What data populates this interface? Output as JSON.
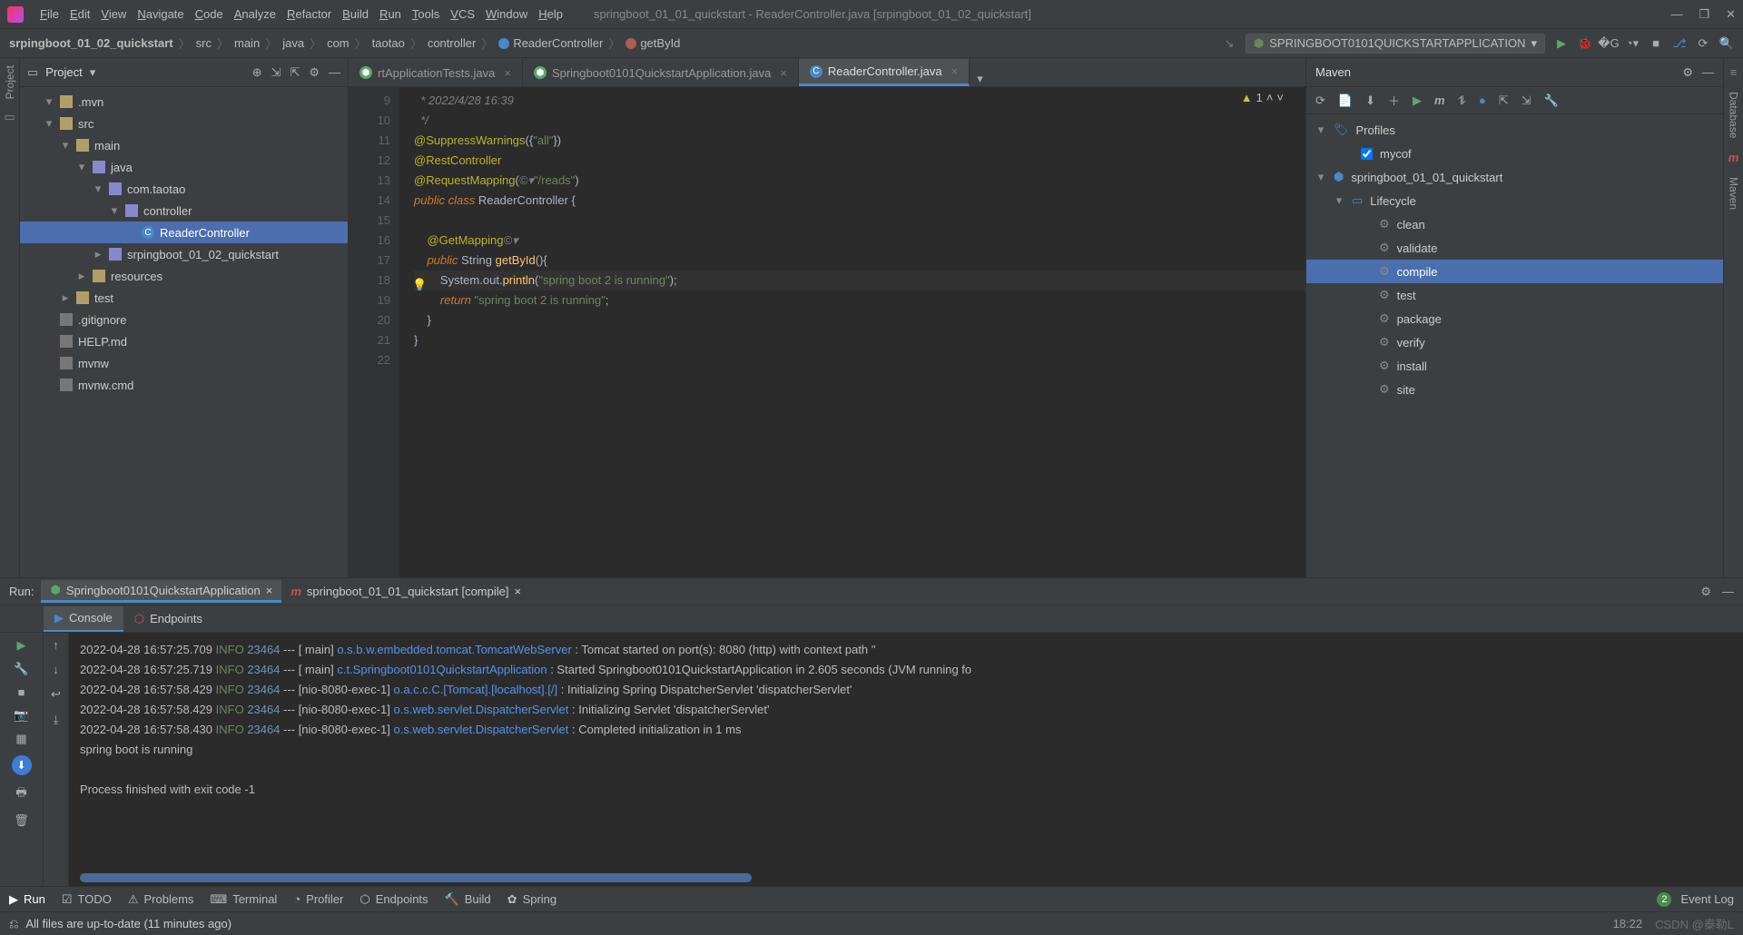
{
  "window": {
    "title": "springboot_01_01_quickstart - ReaderController.java [srpingboot_01_02_quickstart]"
  },
  "menu": [
    "File",
    "Edit",
    "View",
    "Navigate",
    "Code",
    "Analyze",
    "Refactor",
    "Build",
    "Run",
    "Tools",
    "VCS",
    "Window",
    "Help"
  ],
  "breadcrumb": [
    "srpingboot_01_02_quickstart",
    "src",
    "main",
    "java",
    "com",
    "taotao",
    "controller",
    "ReaderController",
    "getById"
  ],
  "runconfig": "SPRINGBOOT0101QUICKSTARTAPPLICATION",
  "project": {
    "title": "Project",
    "tree": [
      {
        "d": 1,
        "exp": "▾",
        "icon": "fold",
        "label": ".mvn"
      },
      {
        "d": 1,
        "exp": "▾",
        "icon": "fold",
        "label": "src"
      },
      {
        "d": 2,
        "exp": "▾",
        "icon": "fold",
        "label": "main"
      },
      {
        "d": 3,
        "exp": "▾",
        "icon": "pkg",
        "label": "java"
      },
      {
        "d": 4,
        "exp": "▾",
        "icon": "pkg",
        "label": "com.taotao"
      },
      {
        "d": 5,
        "exp": "▾",
        "icon": "pkg",
        "label": "controller"
      },
      {
        "d": 6,
        "exp": "",
        "icon": "cls",
        "label": "ReaderController",
        "sel": true
      },
      {
        "d": 4,
        "exp": "▸",
        "icon": "pkg",
        "label": "srpingboot_01_02_quickstart"
      },
      {
        "d": 3,
        "exp": "▸",
        "icon": "fold",
        "label": "resources"
      },
      {
        "d": 2,
        "exp": "▸",
        "icon": "fold",
        "label": "test"
      },
      {
        "d": 1,
        "exp": "",
        "icon": "file",
        "label": ".gitignore"
      },
      {
        "d": 1,
        "exp": "",
        "icon": "file",
        "label": "HELP.md"
      },
      {
        "d": 1,
        "exp": "",
        "icon": "file",
        "label": "mvnw"
      },
      {
        "d": 1,
        "exp": "",
        "icon": "file",
        "label": "mvnw.cmd"
      }
    ]
  },
  "tabs": [
    {
      "label": "rtApplicationTests.java",
      "active": false
    },
    {
      "label": "Springboot0101QuickstartApplication.java",
      "active": false
    },
    {
      "label": "ReaderController.java",
      "active": true
    }
  ],
  "code": {
    "firstline": 9,
    "warn": "1",
    "lines": [
      {
        "n": 9,
        "html": "<span class='c'>  * 2022/4/28 16:39</span>"
      },
      {
        "n": 10,
        "html": "<span class='c'>  */</span>"
      },
      {
        "n": 11,
        "html": "<span class='an'>@SuppressWarnings</span>({<span class='s'>\"all\"</span>})"
      },
      {
        "n": 12,
        "html": "<span class='an'>@RestController</span>"
      },
      {
        "n": 13,
        "html": "<span class='an'>@RequestMapping</span>(<span class='c'>©▾</span><span class='s'>\"/reads\"</span>)"
      },
      {
        "n": 14,
        "html": "<span class='k'>public class</span> <span class='t'>ReaderController</span> {"
      },
      {
        "n": 15,
        "html": ""
      },
      {
        "n": 16,
        "html": "    <span class='an'>@GetMapping</span><span class='c'>©▾</span>"
      },
      {
        "n": 17,
        "html": "    <span class='k'>public</span> <span class='t'>String</span> <span class='m'>getById</span>(){"
      },
      {
        "n": 18,
        "html": "        System.<span class='t'>out</span>.<span class='m'>println</span>(<span class='s'>\"spring boot 2 is running\"</span>);",
        "hl": true
      },
      {
        "n": 19,
        "html": "        <span class='k'>return</span> <span class='s'>\"spring boot 2 is running\"</span>;"
      },
      {
        "n": 20,
        "html": "    }"
      },
      {
        "n": 21,
        "html": "}"
      },
      {
        "n": 22,
        "html": ""
      }
    ]
  },
  "maven": {
    "title": "Maven",
    "profiles": "Profiles",
    "profile_item": "mycof",
    "project": "springboot_01_01_quickstart",
    "lifecycle": "Lifecycle",
    "goals": [
      "clean",
      "validate",
      "compile",
      "test",
      "package",
      "verify",
      "install",
      "site"
    ]
  },
  "run": {
    "label": "Run:",
    "tabs": [
      {
        "label": "Springboot0101QuickstartApplication",
        "active": true
      },
      {
        "label": "springboot_01_01_quickstart [compile]",
        "active": false
      }
    ],
    "subtabs": [
      {
        "label": "Console",
        "active": true
      },
      {
        "label": "Endpoints",
        "active": false
      }
    ],
    "lines": [
      {
        "ts": "2022-04-28 16:57:25.709",
        "lvl": "INFO",
        "pid": "23464",
        "thr": "--- [           main]",
        "src": "o.s.b.w.embedded.tomcat.TomcatWebServer",
        "msg": ": Tomcat started on port(s): 8080 (http) with context path ''"
      },
      {
        "ts": "2022-04-28 16:57:25.719",
        "lvl": "INFO",
        "pid": "23464",
        "thr": "--- [           main]",
        "src": "c.t.Springboot0101QuickstartApplication",
        "msg": ": Started Springboot0101QuickstartApplication in 2.605 seconds (JVM running fo"
      },
      {
        "ts": "2022-04-28 16:57:58.429",
        "lvl": "INFO",
        "pid": "23464",
        "thr": "--- [nio-8080-exec-1]",
        "src": "o.a.c.c.C.[Tomcat].[localhost].[/]",
        "msg": ": Initializing Spring DispatcherServlet 'dispatcherServlet'"
      },
      {
        "ts": "2022-04-28 16:57:58.429",
        "lvl": "INFO",
        "pid": "23464",
        "thr": "--- [nio-8080-exec-1]",
        "src": "o.s.web.servlet.DispatcherServlet",
        "msg": ": Initializing Servlet 'dispatcherServlet'"
      },
      {
        "ts": "2022-04-28 16:57:58.430",
        "lvl": "INFO",
        "pid": "23464",
        "thr": "--- [nio-8080-exec-1]",
        "src": "o.s.web.servlet.DispatcherServlet",
        "msg": ": Completed initialization in 1 ms"
      }
    ],
    "plain": [
      "spring boot is running",
      "",
      "Process finished with exit code -1"
    ]
  },
  "bottom": [
    "Run",
    "TODO",
    "Problems",
    "Terminal",
    "Profiler",
    "Endpoints",
    "Build",
    "Spring"
  ],
  "eventlog": {
    "count": "2",
    "label": "Event Log"
  },
  "status": {
    "msg": "All files are up-to-date (11 minutes ago)",
    "time": "18:22",
    "watermark": "CSDN @泰勒L"
  }
}
